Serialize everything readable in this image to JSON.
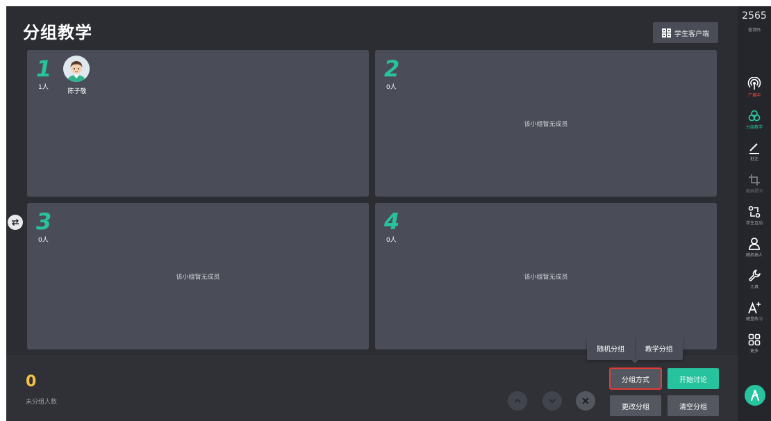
{
  "header": {
    "title": "分组教学",
    "client_button_label": "学生客户端"
  },
  "groups": [
    {
      "number": "1",
      "count": "1人",
      "members": [
        "陈子敬"
      ],
      "empty_text": ""
    },
    {
      "number": "2",
      "count": "0人",
      "members": [],
      "empty_text": "该小组暂无成员"
    },
    {
      "number": "3",
      "count": "0人",
      "members": [],
      "empty_text": "该小组暂无成员"
    },
    {
      "number": "4",
      "count": "0人",
      "members": [],
      "empty_text": "该小组暂无成员"
    }
  ],
  "bottom": {
    "unassigned_count": "0",
    "unassigned_label": "未分组人数",
    "group_method_label": "分组方式",
    "start_discussion_label": "开始讨论",
    "change_group_label": "更改分组",
    "clear_group_label": "清空分组"
  },
  "popover": {
    "random_label": "随机分组",
    "teaching_label": "教学分组"
  },
  "sidebar": {
    "invite_code": "2565",
    "invite_label": "邀请码",
    "items": [
      {
        "label": "广播中",
        "icon": "broadcast-icon"
      },
      {
        "label": "分组教学",
        "icon": "group-icon"
      },
      {
        "label": "批注",
        "icon": "pen-icon"
      },
      {
        "label": "截屏提问",
        "icon": "crop-icon"
      },
      {
        "label": "学生互动",
        "icon": "interaction-icon"
      },
      {
        "label": "随机抽人",
        "icon": "person-icon"
      },
      {
        "label": "工具",
        "icon": "wrench-icon"
      },
      {
        "label": "随堂练习",
        "icon": "font-plus-icon"
      },
      {
        "label": "更多",
        "icon": "grid-icon"
      }
    ]
  },
  "colors": {
    "accent": "#27c39e",
    "broadcast": "#e84a4a",
    "count": "#f7c245",
    "highlight": "#e53935"
  }
}
